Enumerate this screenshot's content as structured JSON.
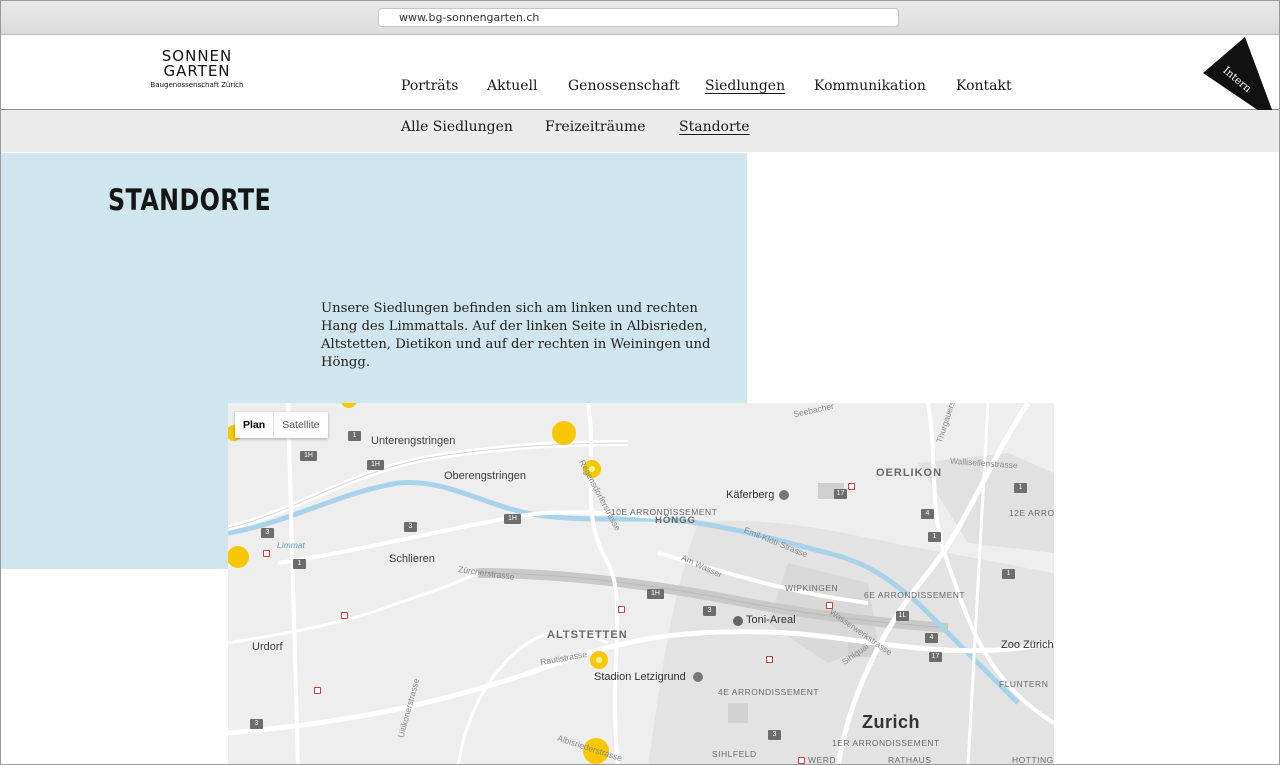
{
  "browser": {
    "url": "www.bg-sonnengarten.ch"
  },
  "logo": {
    "line1": "SONNEN",
    "line2": "GARTEN",
    "line3": "Baugenossenschaft Zürich"
  },
  "nav": {
    "items": [
      {
        "label": "Porträts"
      },
      {
        "label": "Aktuell"
      },
      {
        "label": "Genossenschaft"
      },
      {
        "label": "Siedlungen",
        "active": true
      },
      {
        "label": "Kommunikation"
      },
      {
        "label": "Kontakt"
      }
    ]
  },
  "intern": {
    "label": "Intern"
  },
  "subnav": {
    "items": [
      {
        "label": "Alle Siedlungen"
      },
      {
        "label": "Freizeiträume"
      },
      {
        "label": "Standorte",
        "active": true
      }
    ]
  },
  "page": {
    "title": "STANDORTE",
    "intro": "Unsere Siedlungen befinden sich am linken und rechten Hang des Limmattals. Auf der linken Seite in Albisrieden, Altstetten, Dietikon und auf der rechten in Weiningen und Höngg."
  },
  "map": {
    "toggle": {
      "plan": "Plan",
      "satellite": "Satellite"
    },
    "marker_color": "#f7c800",
    "labels": {
      "unterengstringen": "Unterengstringen",
      "oberengstringen": "Oberengstringen",
      "schlieren": "Schlieren",
      "urdorf": "Urdorf",
      "altstetten": "ALTSTETTEN",
      "hoengg": "HÖNGG",
      "oerlikon": "OERLIKON",
      "zurich": "Zurich",
      "arr10": "10E ARRONDISSEMENT",
      "arr6": "6E ARRONDISSEMENT",
      "arr4": "4E ARRONDISSEMENT",
      "arr12": "12E ARRO",
      "arr1": "1ER ARRONDISSEMENT",
      "wipkingen": "WIPKINGEN",
      "fluntern": "FLUNTERN",
      "sihlfeld": "SIHLFELD",
      "werd": "WERD",
      "rathaus": "RATHAUS",
      "hottinge": "HOTTINGE",
      "kaeferberg": "Käferberg",
      "toni_areal": "Toni-Areal",
      "stadion": "Stadion Letzigrund",
      "zoo": "Zoo Zürich",
      "limmat": "Limmat",
      "zuercherstrasse": "Zürcherstrasse",
      "rautistrasse": "Rautistrasse",
      "regensdorferstrasse": "Regensdorferstrasse",
      "am_wasser": "Am Wasser",
      "emil_kloeti": "Emil-Klöti-Strasse",
      "wasserwerkstrasse": "Wasserwerkstrasse",
      "sihlquai": "Sihlquai",
      "uitikonerstrasse": "Uitikonerstrasse",
      "albisriederstrasse": "Albisriederstrasse",
      "wallisellenstrasse": "Wallisellenstrasse",
      "thurgauerstrasse": "Thurgauerstrasse",
      "seebacherstrasse": "Seebacher"
    },
    "shields": {
      "s1": "1",
      "s1h": "1H",
      "s3": "3",
      "s4": "4",
      "s17": "17",
      "s1l": "1L"
    }
  }
}
